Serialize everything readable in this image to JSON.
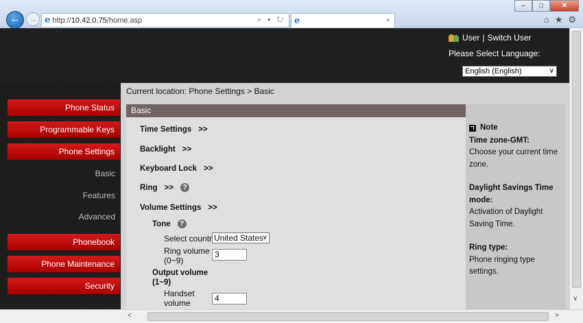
{
  "browser": {
    "url_prefix": "http://",
    "url_host": "10.42.0.75",
    "url_path": "/home.asp",
    "addr_tools": "⌕ ▾ ↻",
    "tab_close": "×",
    "window_buttons": {
      "minimize": "–",
      "maximize": "□",
      "close": "✕"
    },
    "toolbar_icons": {
      "home": "⌂",
      "favorites": "★",
      "settings": "⚙"
    },
    "back": "←",
    "forward": "→"
  },
  "header": {
    "user_label": "User",
    "separator": "|",
    "switch_user": "Switch User",
    "language_label": "Please Select Language:",
    "language_value": "English (English)",
    "select_arrow": "∨"
  },
  "sidebar": {
    "items": [
      {
        "label": "Phone Status"
      },
      {
        "label": "Programmable Keys"
      },
      {
        "label": "Phone Settings"
      },
      {
        "label": "Basic"
      },
      {
        "label": "Features"
      },
      {
        "label": "Advanced"
      },
      {
        "label": "Phonebook"
      },
      {
        "label": "Phone Maintenance"
      },
      {
        "label": "Security"
      }
    ]
  },
  "main": {
    "breadcrumb": "Current location: Phone Settings > Basic",
    "panel_title": "Basic",
    "sections": {
      "time_settings": "Time Settings",
      "backlight": "Backlight",
      "keyboard_lock": "Keyboard Lock",
      "ring": "Ring",
      "volume_settings": "Volume Settings",
      "expand": ">>",
      "help": "?"
    },
    "tone": {
      "label": "Tone",
      "select_country_label": "Select country",
      "country_value": "United States",
      "ring_volume_label": "Ring volume",
      "ring_volume_range": "(0~9)",
      "ring_volume_value": "3"
    },
    "output_volume": {
      "label": "Output volume",
      "range": "(1~9)",
      "handset_label": "Handset",
      "handset_label2": "volume",
      "handset_value": "4"
    }
  },
  "note": {
    "title": "Note",
    "items": [
      {
        "heading": "Time zone-GMT:",
        "text": "Choose your current time zone."
      },
      {
        "heading": "Daylight Savings Time mode:",
        "text": "Activation of Daylight Saving Time."
      },
      {
        "heading": "Ring type:",
        "text": "Phone ringing type settings."
      }
    ]
  },
  "scroll": {
    "up": "▲",
    "down": "∨",
    "left": "<",
    "right": ">"
  }
}
